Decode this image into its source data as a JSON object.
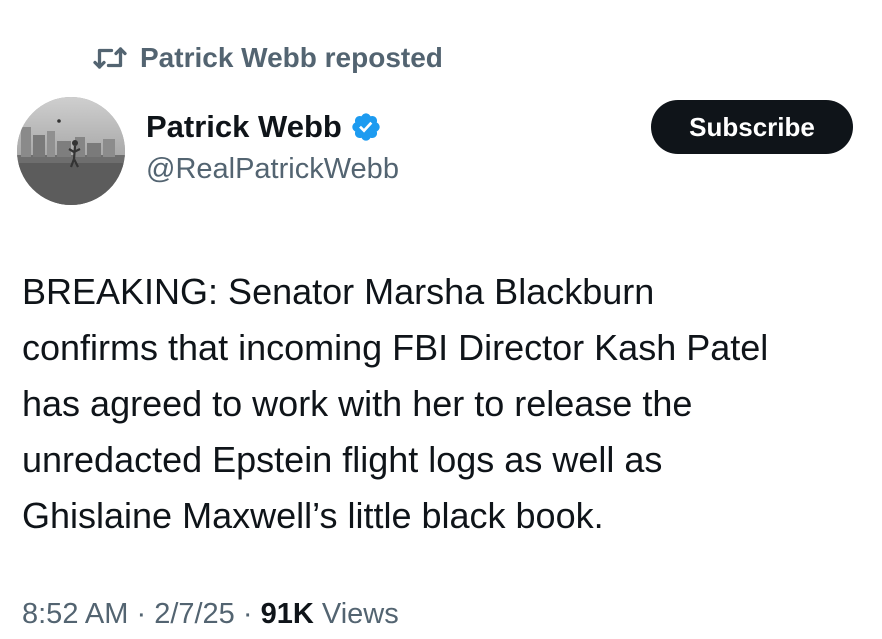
{
  "repost": {
    "icon": "repost-icon",
    "text": "Patrick Webb reposted"
  },
  "author": {
    "name": "Patrick Webb",
    "handle": "@RealPatrickWebb",
    "verified_icon": "verified-badge-icon",
    "verified_color": "#1d9bf0"
  },
  "subscribe_label": "Subscribe",
  "tweet": {
    "text": "BREAKING: Senator Marsha Blackburn\nconfirms that incoming FBI Director Kash Patel\nhas agreed to work with her to release the\nunredacted Epstein flight logs as well as\nGhislaine Maxwell’s little black book."
  },
  "meta": {
    "time": "8:52 AM",
    "separator": " · ",
    "date": "2/7/25",
    "views_count": "91K",
    "views_label": " Views"
  },
  "colors": {
    "text_primary": "#0f1419",
    "text_secondary": "#536471",
    "button_bg": "#0f1419",
    "button_text": "#ffffff"
  }
}
